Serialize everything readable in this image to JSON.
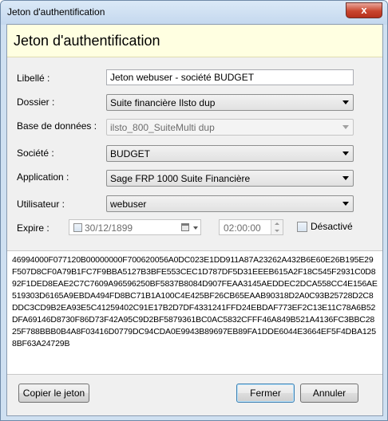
{
  "window": {
    "title": "Jeton d'authentification",
    "close_glyph": "x"
  },
  "header": {
    "title": "Jeton d'authentification"
  },
  "form": {
    "libelle": {
      "label": "Libellé :",
      "value": "Jeton webuser - société BUDGET"
    },
    "dossier": {
      "label": "Dossier :",
      "value": "Suite financière Ilsto dup"
    },
    "base": {
      "label": "Base de données :",
      "value": "ilsto_800_SuiteMulti dup",
      "disabled": true
    },
    "societe": {
      "label": "Société :",
      "value": "BUDGET"
    },
    "application": {
      "label": "Application :",
      "value": "Sage FRP 1000 Suite Financière"
    },
    "utilisateur": {
      "label": "Utilisateur :",
      "value": "webuser"
    },
    "expire": {
      "label": "Expire :",
      "date": "30/12/1899",
      "time": "02:00:00",
      "desactive_label": "Désactivé",
      "desactive_checked": false
    }
  },
  "token": {
    "value": "46994000F077120B00000000F700620056A0DC023E1DD911A87A23262A432B6E60E26B195E29F507D8CF0A79B1FC7F9BBA5127B3BFE553CEC1D787DF5D31EEEB615A2F18C545F2931C0D892F1DED8EAE2C7C7609A96596250BF5837B8084D907FEAA3145AEDDEC2DCA558CC4E156AE519303D6165A9EBDA494FD8BC71B1A100C4E425BF26CB65EAAB90318D2A0C93B25728D2C8DDC3CD9B2EA93E5C41259402C91E17B2D7DF4331241FFD24EBDAF773EF2C13E11C78A6B52DFA69146D8730F86D73F42A95C9D2BF5879361BC0AC5832CFFF46A849B521A4136FC3BBC2825F788BBB0B4A8F03416D0779DC94CDA0E9943B89697EB89FA1DDE6044E3664EF5F4DBA1258BF63A24729B"
  },
  "buttons": {
    "copy": "Copier le jeton",
    "close": "Fermer",
    "cancel": "Annuler"
  }
}
